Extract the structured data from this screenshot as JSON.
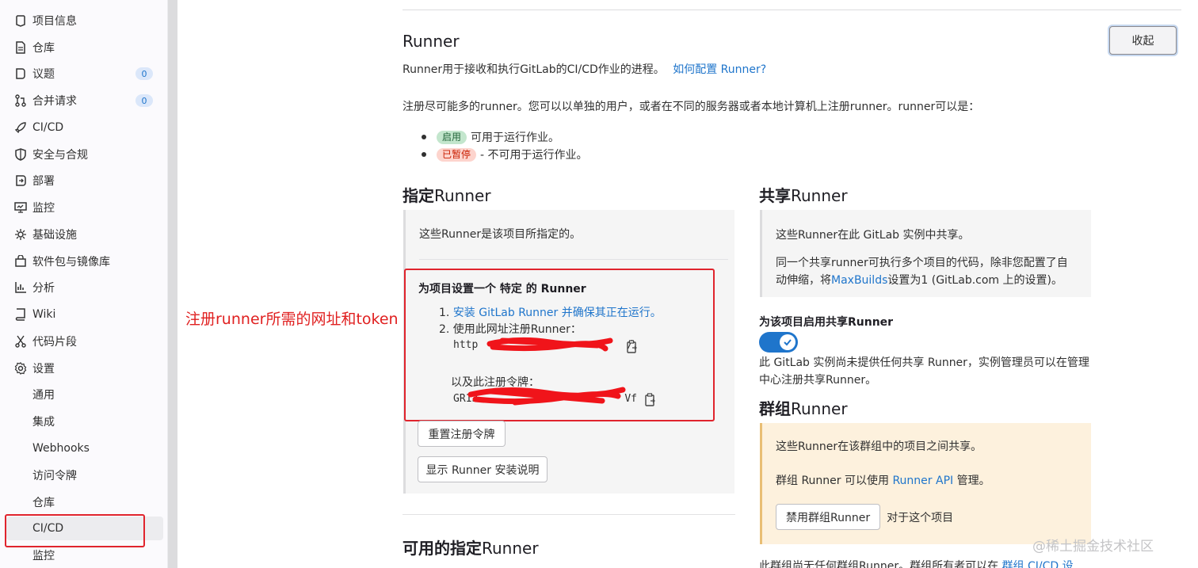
{
  "sidebar": {
    "items": [
      {
        "label": "项目信息",
        "icon": "info-icon"
      },
      {
        "label": "仓库",
        "icon": "repository-icon"
      },
      {
        "label": "议题",
        "icon": "issues-icon",
        "badge": "0"
      },
      {
        "label": "合并请求",
        "icon": "merge-request-icon",
        "badge": "0"
      },
      {
        "label": "CI/CD",
        "icon": "rocket-icon"
      },
      {
        "label": "安全与合规",
        "icon": "shield-icon"
      },
      {
        "label": "部署",
        "icon": "deployments-icon"
      },
      {
        "label": "监控",
        "icon": "monitor-icon"
      },
      {
        "label": "基础设施",
        "icon": "cloud-gear-icon"
      },
      {
        "label": "软件包与镜像库",
        "icon": "package-icon"
      },
      {
        "label": "分析",
        "icon": "chart-icon"
      },
      {
        "label": "Wiki",
        "icon": "book-icon"
      },
      {
        "label": "代码片段",
        "icon": "scissors-icon"
      },
      {
        "label": "设置",
        "icon": "gear-icon"
      }
    ],
    "settings_sub": [
      "通用",
      "集成",
      "Webhooks",
      "访问令牌",
      "仓库",
      "CI/CD",
      "监控"
    ],
    "active_sub": "CI/CD"
  },
  "annotation": "注册runner所需的网址和token",
  "runner_section": {
    "title": "Runner",
    "collapse_label": "收起",
    "desc": "Runner用于接收和执行GitLab的CI/CD作业的进程。",
    "desc_link": "如何配置 Runner?",
    "register_text": "注册尽可能多的runner。您可以以单独的用户，或者在不同的服务器或者本地计算机上注册runner。runner可以是：",
    "status_active_badge": "启用",
    "status_active_text": "可用于运行作业。",
    "status_paused_badge": "已暂停",
    "status_paused_text": "- 不可用于运行作业。"
  },
  "specific": {
    "title_bold": "指定",
    "title_rest": "Runner",
    "box_text": "这些Runner是该项目所指定的。",
    "setup_title_a": "为项目设置一个",
    "setup_title_b": "特定",
    "setup_title_c": "的 Runner",
    "step1_num": "1.",
    "step1_link": "安装 GitLab Runner 并确保其正在运行。",
    "step2": "2. 使用此网址注册Runner：",
    "url_prefix": "http",
    "url_suffix": "/",
    "token_label": "以及此注册令牌：",
    "token_prefix": "GR13",
    "token_suffix": "Vf",
    "reset_btn": "重置注册令牌",
    "show_btn": "显示 Runner 安装说明",
    "available_title_bold": "可用的指定",
    "available_title_rest": "Runner"
  },
  "shared": {
    "title_bold": "共享",
    "title_rest": "Runner",
    "box_t1": "这些Runner在此 GitLab 实例中共享。",
    "box_t2a": "同一个共享runner可执行多个项目的代码，除非您配置了自动伸缩，将",
    "box_t2_link": "MaxBuilds",
    "box_t2b": "设置为1 (GitLab.com 上的设置)。",
    "enable_title": "为该项目启用共享Runner",
    "toggle_on": true,
    "enable_desc": "此 GitLab 实例尚未提供任何共享 Runner，实例管理员可以在管理中心注册共享Runner。"
  },
  "group": {
    "title_bold": "群组",
    "title_rest": "Runner",
    "box_t1": "这些Runner在该群组中的项目之间共享。",
    "box_t2a": "群组 Runner 可以使用",
    "box_t2_link": "Runner API",
    "box_t2b": "管理。",
    "disable_btn": "禁用群组Runner",
    "for_project": "对于这个项目",
    "bottom_text": "此群组尚无任何群组Runner。群组所有者可以在",
    "bottom_link": "群组 CI/CD 设"
  },
  "watermark": "@稀土掘金技术社区",
  "colors": {
    "link": "#1f75cb",
    "annotation_red": "#e02020",
    "toggle": "#1f75cb",
    "warning_bg": "#fdf1dd"
  }
}
